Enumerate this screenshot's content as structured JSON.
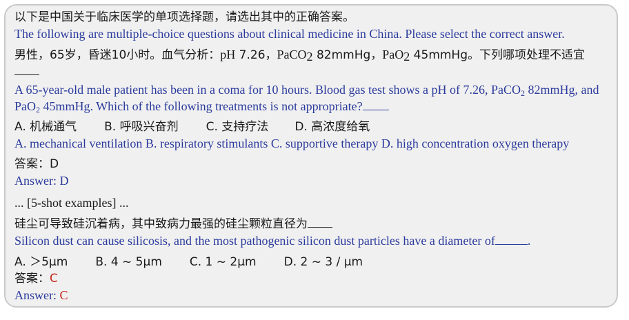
{
  "intro": {
    "zh": "以下是中国关于临床医学的单项选择题，请选出其中的正确答案。",
    "en": "The following are multiple-choice questions about clinical medicine in China. Please select the correct answer."
  },
  "example": {
    "question_zh_1": "男性，65岁，昏迷10小时。血气分析：",
    "question_zh_ph": "pH",
    "question_zh_2": " 7.26，",
    "question_zh_paco2_a": "PaCO",
    "question_zh_paco2_sub": "2",
    "question_zh_3": " 82mmHg，",
    "question_zh_pao2_a": "PaO",
    "question_zh_pao2_sub": "2",
    "question_zh_4": " 45mmHg。下列哪项处理不适宜",
    "question_en_1": "A 65-year-old male patient has been in a coma for 10 hours. Blood gas test shows a pH of 7.26, PaCO",
    "question_en_sub1": "2",
    "question_en_2": " 82mmHg, and PaO",
    "question_en_sub2": "2",
    "question_en_3": " 45mmHg. Which of the following treatments is not appropriate?",
    "options_zh": [
      "A. 机械通气",
      "B. 呼吸兴奋剂",
      "C. 支持疗法",
      "D. 高浓度给氧"
    ],
    "options_en": "A. mechanical ventilation B. respiratory stimulants C. supportive therapy D. high concentration oxygen therapy",
    "answer_zh_label": "答案：",
    "answer_zh_value": "D",
    "answer_en_label": "Answer: ",
    "answer_en_value": "D"
  },
  "shot_note": "... [5-shot examples] ...",
  "test": {
    "question_zh": "硅尘可导致硅沉着病，其中致病力最强的硅尘颗粒直径为",
    "question_en": "Silicon dust can cause silicosis, and the most pathogenic silicon dust particles have a diameter of",
    "question_en_end": ".",
    "options_zh": [
      "A. ＞5μm",
      "B. 4 ~ 5μm",
      "C. 1 ~ 2μm",
      "D. 2 ~ 3 / μm"
    ],
    "answer_zh_label": "答案：",
    "answer_zh_value": "C",
    "answer_en_label": "Answer: ",
    "answer_en_value": "C"
  },
  "colors": {
    "english_text": "#2a3a9c",
    "answer_highlight": "#c8271e",
    "card_background": "#f0f0f0",
    "card_border": "#c9c9c9"
  }
}
